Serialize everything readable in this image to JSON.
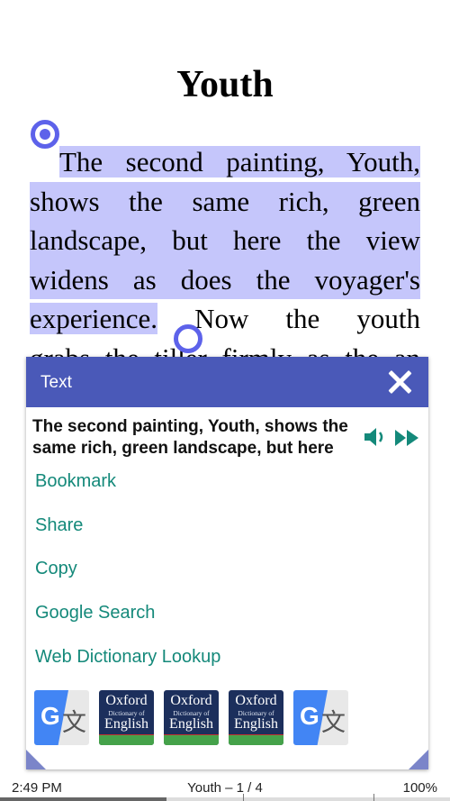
{
  "reader": {
    "title": "Youth",
    "lines": [
      {
        "text": "The second painting, Youth,",
        "highlighted": true
      },
      {
        "text": "shows the same rich, green",
        "highlighted": true
      },
      {
        "text": "landscape, but here the view",
        "highlighted": true
      },
      {
        "text": "widens as does the voyager's",
        "highlighted": true
      },
      {
        "text": "experience.",
        "highlighted": true,
        "rest": " Now the youth"
      },
      {
        "text": "grabs the tiller firmly as the an",
        "highlighted": false
      }
    ]
  },
  "popup": {
    "title": "Text",
    "selected_text": "The second painting, Youth, shows the same rich, green landscape, but here",
    "actions": [
      "Bookmark",
      "Share",
      "Copy",
      "Google Search",
      "Web Dictionary Lookup"
    ],
    "apps": [
      {
        "type": "google-translate",
        "glyph_g": "G",
        "glyph_wen": "文"
      },
      {
        "type": "oxford",
        "line1": "Oxford",
        "line2": "Dictionary of",
        "line3": "English"
      },
      {
        "type": "oxford",
        "line1": "Oxford",
        "line2": "Dictionary of",
        "line3": "English"
      },
      {
        "type": "oxford",
        "line1": "Oxford",
        "line2": "Dictionary of",
        "line3": "English"
      },
      {
        "type": "google-translate",
        "glyph_g": "G",
        "glyph_wen": "文"
      }
    ],
    "accent_color": "#4a59b8",
    "action_color": "#14897a"
  },
  "status": {
    "time": "2:49 PM",
    "chapter": "Youth – 1 / 4",
    "percent": "100%",
    "progress": 0.37
  },
  "highlight_color": "#c5c6fb"
}
